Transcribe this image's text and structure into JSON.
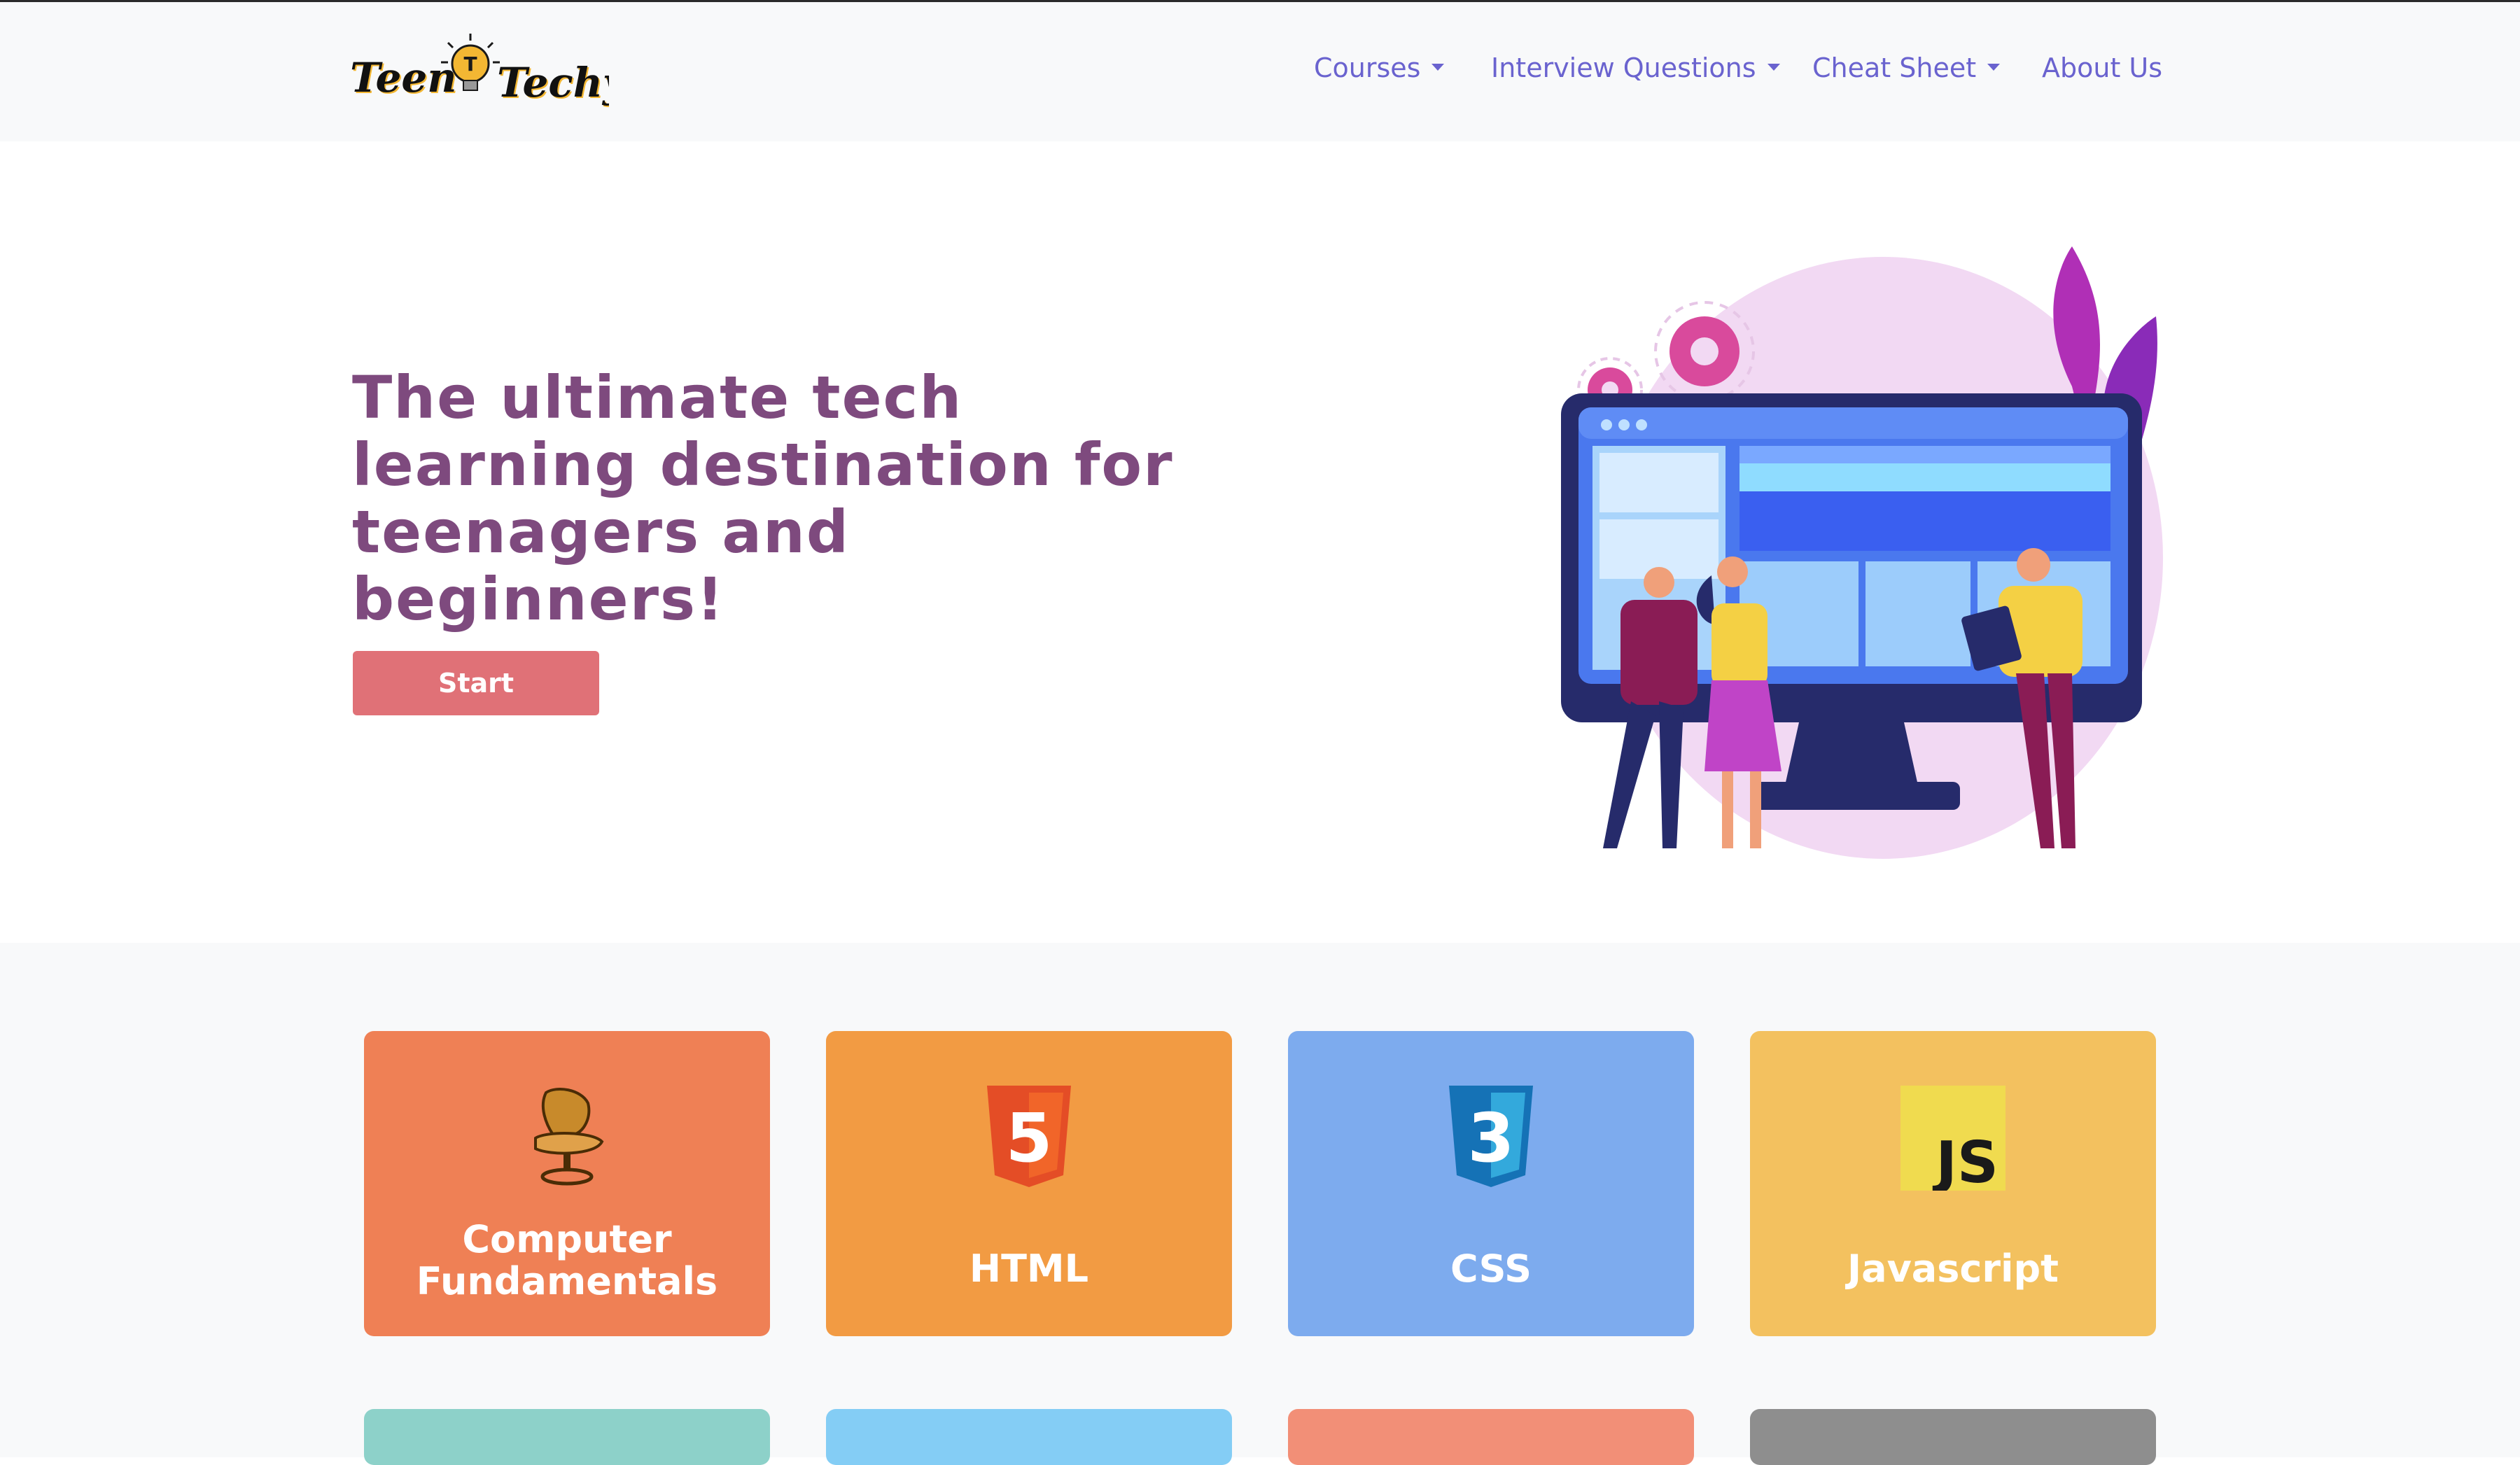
{
  "brand": {
    "logo_text_1": "Teen",
    "logo_text_2": "Techy"
  },
  "nav": {
    "items": [
      {
        "label": "Courses",
        "has_dropdown": true
      },
      {
        "label": "Interview Questions",
        "has_dropdown": true
      },
      {
        "label": "Cheat Sheet",
        "has_dropdown": true
      },
      {
        "label": "About Us",
        "has_dropdown": false
      }
    ]
  },
  "hero": {
    "title": "The ultimate tech learning destination for teenagers and beginners!",
    "start_label": "Start"
  },
  "courses": [
    {
      "title": "Computer Fundamentals",
      "color": "#ef8055",
      "icon": "computer-chair-icon"
    },
    {
      "title": "HTML",
      "color": "#f29b43",
      "icon": "html5-icon",
      "badge": "5"
    },
    {
      "title": "CSS",
      "color": "#7dabee",
      "icon": "css3-icon",
      "badge": "3"
    },
    {
      "title": "Javascript",
      "color": "#f3c15f",
      "icon": "js-icon",
      "badge": "JS"
    }
  ],
  "more_cards_colors": [
    "#8dd1c9",
    "#84cdf5",
    "#f28f77",
    "#8e8e8e"
  ]
}
